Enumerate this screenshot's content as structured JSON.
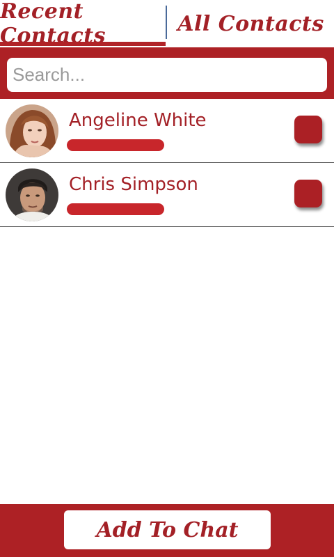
{
  "tabs": [
    {
      "label": "Recent Contacts",
      "selected": true
    },
    {
      "label": "All Contacts",
      "selected": false
    }
  ],
  "search": {
    "placeholder": "Search...",
    "value": ""
  },
  "contacts": [
    {
      "name": "Angeline White",
      "avatar_icon": "female-avatar-photo",
      "checked": false
    },
    {
      "name": "Chris Simpson",
      "avatar_icon": "male-avatar-photo",
      "checked": false
    }
  ],
  "footer": {
    "button_label": "Add To Chat"
  },
  "colors": {
    "accent": "#ad2125",
    "text_accent": "#a32026",
    "background": "#ffffff"
  }
}
